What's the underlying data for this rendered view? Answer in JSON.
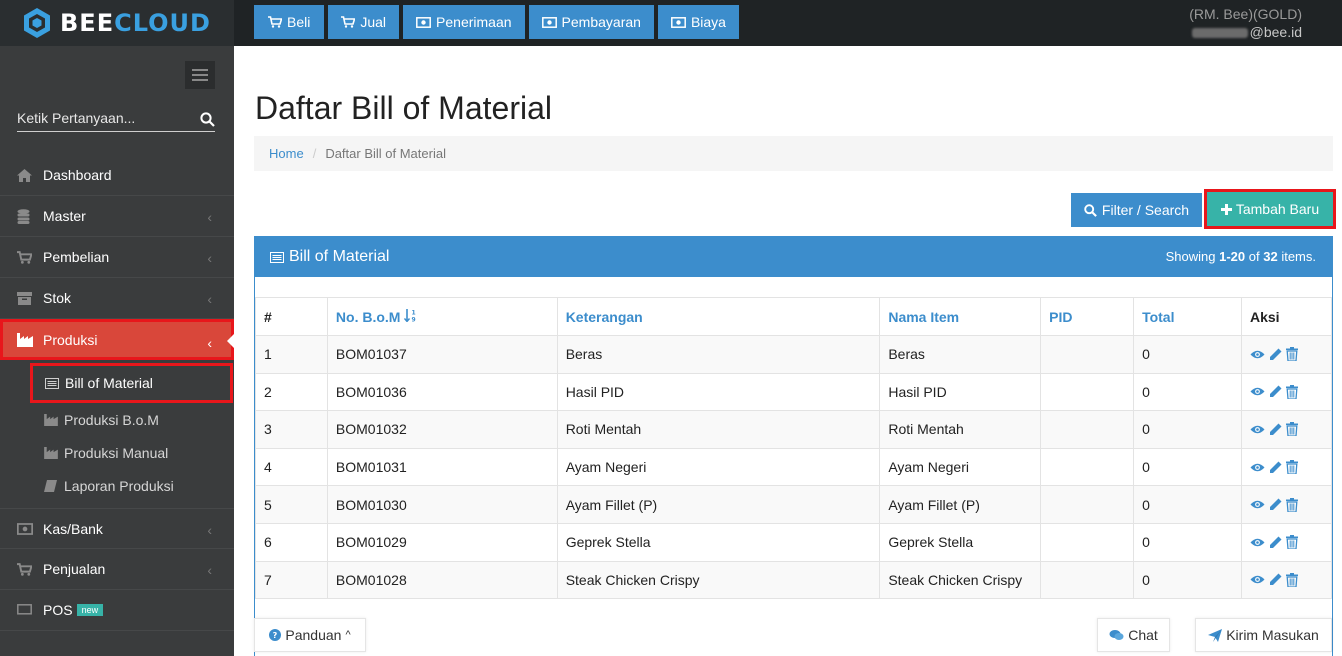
{
  "brand": {
    "part1": "BEE",
    "part2": "CLOUD"
  },
  "topnav": [
    {
      "label": "Beli",
      "icon": "cart-icon"
    },
    {
      "label": "Jual",
      "icon": "cart-icon"
    },
    {
      "label": "Penerimaan",
      "icon": "money-icon"
    },
    {
      "label": "Pembayaran",
      "icon": "money-icon"
    },
    {
      "label": "Biaya",
      "icon": "money-icon"
    }
  ],
  "user": {
    "company": "(RM. Bee)(GOLD)",
    "email_suffix": "@bee.id"
  },
  "sidebar": {
    "search_placeholder": "Ketik Pertanyaan...",
    "items": [
      {
        "label": "Dashboard",
        "icon": "home-icon"
      },
      {
        "label": "Master",
        "icon": "database-icon"
      },
      {
        "label": "Pembelian",
        "icon": "cart-icon"
      },
      {
        "label": "Stok",
        "icon": "archive-icon"
      },
      {
        "label": "Produksi",
        "icon": "industry-icon"
      },
      {
        "label": "Kas/Bank",
        "icon": "money-icon"
      },
      {
        "label": "Penjualan",
        "icon": "cart-icon"
      },
      {
        "label": "POS",
        "icon": "monitor-icon",
        "badge": "new"
      }
    ],
    "produksi_sub": [
      {
        "label": "Bill of Material",
        "icon": "list-icon"
      },
      {
        "label": "Produksi B.o.M",
        "icon": "industry-icon"
      },
      {
        "label": "Produksi Manual",
        "icon": "industry-icon"
      },
      {
        "label": "Laporan Produksi",
        "icon": "book-icon"
      }
    ]
  },
  "page": {
    "title": "Daftar Bill of Material",
    "breadcrumb_home": "Home",
    "breadcrumb_current": "Daftar Bill of Material",
    "filter_label": "Filter / Search",
    "add_label": "Tambah Baru"
  },
  "panel": {
    "title": "Bill of Material",
    "summary_prefix": "Showing ",
    "summary_range": "1-20",
    "summary_mid": " of ",
    "summary_total": "32",
    "summary_suffix": " items."
  },
  "table": {
    "headers": [
      "#",
      "No. B.o.M",
      "Keterangan",
      "Nama Item",
      "PID",
      "Total",
      "Aksi"
    ],
    "rows": [
      {
        "no": "1",
        "bom": "BOM01037",
        "ket": "Beras",
        "item": "Beras",
        "pid": "",
        "total": "0"
      },
      {
        "no": "2",
        "bom": "BOM01036",
        "ket": "Hasil PID",
        "item": "Hasil PID",
        "pid": "",
        "total": "0"
      },
      {
        "no": "3",
        "bom": "BOM01032",
        "ket": "Roti Mentah",
        "item": "Roti Mentah",
        "pid": "",
        "total": "0"
      },
      {
        "no": "4",
        "bom": "BOM01031",
        "ket": "Ayam Negeri",
        "item": "Ayam Negeri",
        "pid": "",
        "total": "0"
      },
      {
        "no": "5",
        "bom": "BOM01030",
        "ket": "Ayam Fillet (P)",
        "item": "Ayam Fillet (P)",
        "pid": "",
        "total": "0"
      },
      {
        "no": "6",
        "bom": "BOM01029",
        "ket": "Geprek Stella",
        "item": "Geprek Stella",
        "pid": "",
        "total": "0"
      },
      {
        "no": "7",
        "bom": "BOM01028",
        "ket": "Steak Chicken Crispy",
        "item": "Steak Chicken Crispy",
        "pid": "",
        "total": "0"
      }
    ]
  },
  "footer": {
    "guide": "Panduan",
    "chat": "Chat",
    "feedback": "Kirim Masukan"
  },
  "colors": {
    "primary": "#3c8dcc",
    "teal": "#37b3a8",
    "active_red": "#d9473a",
    "highlight": "#e8161b",
    "sidebar": "#3a3c3d"
  }
}
